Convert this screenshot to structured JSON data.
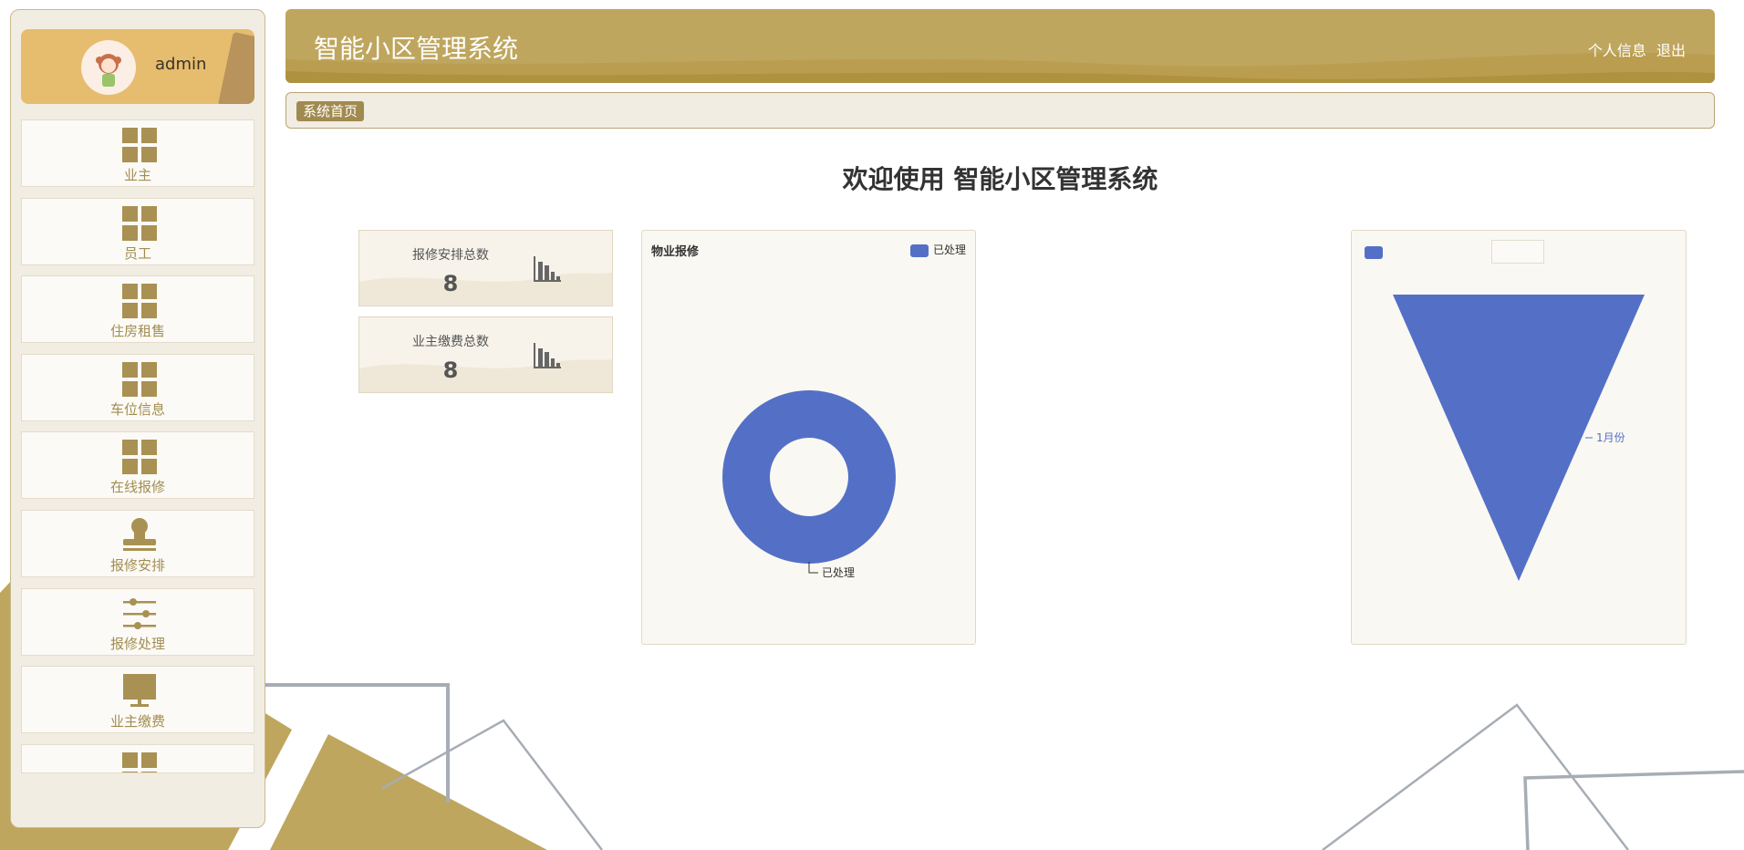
{
  "app": {
    "title": "智能小区管理系统"
  },
  "header": {
    "title": "智能小区管理系统",
    "profile_link": "个人信息",
    "logout_link": "退出"
  },
  "user": {
    "name": "admin"
  },
  "sidebar": {
    "items": [
      {
        "label": "业主",
        "icon": "grid-icon"
      },
      {
        "label": "员工",
        "icon": "grid-icon"
      },
      {
        "label": "住房租售",
        "icon": "grid-icon"
      },
      {
        "label": "车位信息",
        "icon": "grid-icon"
      },
      {
        "label": "在线报修",
        "icon": "grid-icon"
      },
      {
        "label": "报修安排",
        "icon": "stamp-icon"
      },
      {
        "label": "报修处理",
        "icon": "sliders-icon"
      },
      {
        "label": "业主缴费",
        "icon": "monitor-icon"
      },
      {
        "label": "",
        "icon": "grid-icon"
      }
    ]
  },
  "breadcrumb": {
    "home": "系统首页"
  },
  "welcome": "欢迎使用 智能小区管理系统",
  "stats": [
    {
      "label": "报修安排总数",
      "value": "8"
    },
    {
      "label": "业主缴费总数",
      "value": "8"
    }
  ],
  "colors": {
    "accent": "#bfa65e",
    "series": "#5470c6",
    "panel": "#faf8f2"
  },
  "chart_data": [
    {
      "type": "pie",
      "title": "物业报修",
      "legend": [
        "已处理"
      ],
      "slices": [
        {
          "name": "已处理",
          "value": 1
        }
      ],
      "donut": true
    },
    {
      "type": "funnel",
      "categories": [
        "1月份"
      ],
      "values": [
        1
      ]
    }
  ]
}
